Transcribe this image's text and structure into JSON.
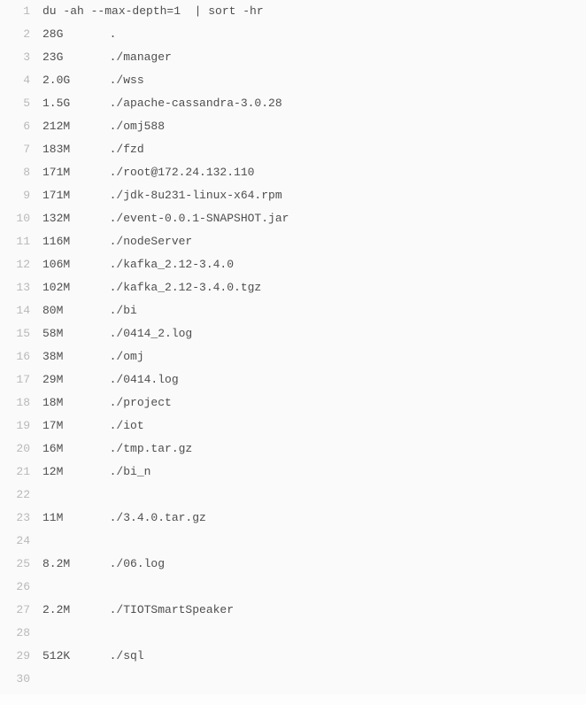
{
  "command": "du -ah --max-depth=1  | sort -hr",
  "rows": [
    {
      "n": 1,
      "text": "du -ah --max-depth=1  | sort -hr"
    },
    {
      "n": 2,
      "size": "28G",
      "path": "."
    },
    {
      "n": 3,
      "size": "23G",
      "path": "./manager"
    },
    {
      "n": 4,
      "size": "2.0G",
      "path": "./wss"
    },
    {
      "n": 5,
      "size": "1.5G",
      "path": "./apache-cassandra-3.0.28"
    },
    {
      "n": 6,
      "size": "212M",
      "path": "./omj588"
    },
    {
      "n": 7,
      "size": "183M",
      "path": "./fzd"
    },
    {
      "n": 8,
      "size": "171M",
      "path": "./root@172.24.132.110"
    },
    {
      "n": 9,
      "size": "171M",
      "path": "./jdk-8u231-linux-x64.rpm"
    },
    {
      "n": 10,
      "size": "132M",
      "path": "./event-0.0.1-SNAPSHOT.jar"
    },
    {
      "n": 11,
      "size": "116M",
      "path": "./nodeServer"
    },
    {
      "n": 12,
      "size": "106M",
      "path": "./kafka_2.12-3.4.0"
    },
    {
      "n": 13,
      "size": "102M",
      "path": "./kafka_2.12-3.4.0.tgz"
    },
    {
      "n": 14,
      "size": "80M",
      "path": "./bi"
    },
    {
      "n": 15,
      "size": "58M",
      "path": "./0414_2.log"
    },
    {
      "n": 16,
      "size": "38M",
      "path": "./omj"
    },
    {
      "n": 17,
      "size": "29M",
      "path": "./0414.log"
    },
    {
      "n": 18,
      "size": "18M",
      "path": "./project"
    },
    {
      "n": 19,
      "size": "17M",
      "path": "./iot"
    },
    {
      "n": 20,
      "size": "16M",
      "path": "./tmp.tar.gz"
    },
    {
      "n": 21,
      "size": "12M",
      "path": "./bi_n"
    },
    {
      "n": 22,
      "blank": true
    },
    {
      "n": 23,
      "size": "11M",
      "path": "./3.4.0.tar.gz"
    },
    {
      "n": 24,
      "blank": true
    },
    {
      "n": 25,
      "size": "8.2M",
      "path": "./06.log"
    },
    {
      "n": 26,
      "blank": true
    },
    {
      "n": 27,
      "size": "2.2M",
      "path": "./TIOTSmartSpeaker"
    },
    {
      "n": 28,
      "blank": true
    },
    {
      "n": 29,
      "size": "512K",
      "path": "./sql"
    },
    {
      "n": 30,
      "blank": true
    }
  ]
}
